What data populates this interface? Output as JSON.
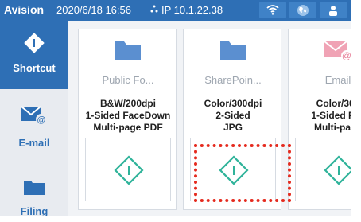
{
  "status_bar": {
    "title": "Avision",
    "datetime": "2020/6/18 16:56",
    "ip_icon": "network-icon",
    "ip": "IP 10.1.22.38",
    "buttons": [
      "wifi-icon",
      "globe-icon",
      "user-icon"
    ]
  },
  "sidebar": {
    "items": [
      {
        "label": "Shortcut",
        "icon": "diamond-start-icon",
        "active": true
      },
      {
        "label": "E-mail",
        "icon": "email-icon",
        "active": false
      },
      {
        "label": "Filing",
        "icon": "folder-icon",
        "active": false
      }
    ]
  },
  "cards": [
    {
      "name": "Public Fo...",
      "icon": "folder-icon",
      "line1": "B&W/200dpi",
      "line2": "1-Sided FaceDown",
      "line3": "Multi-page PDF"
    },
    {
      "name": "SharePoin...",
      "icon": "folder-icon",
      "line1": "Color/300dpi",
      "line2": "2-Sided",
      "line3": "JPG"
    },
    {
      "name": "Email",
      "icon": "email-icon",
      "line1": "Color/300",
      "line2": "1-Sided Fac",
      "line3": "Multi-page"
    }
  ],
  "colors": {
    "brand_blue": "#2e6fb5",
    "accent_green": "#2fb39a",
    "highlight_red": "#e52b1f"
  }
}
